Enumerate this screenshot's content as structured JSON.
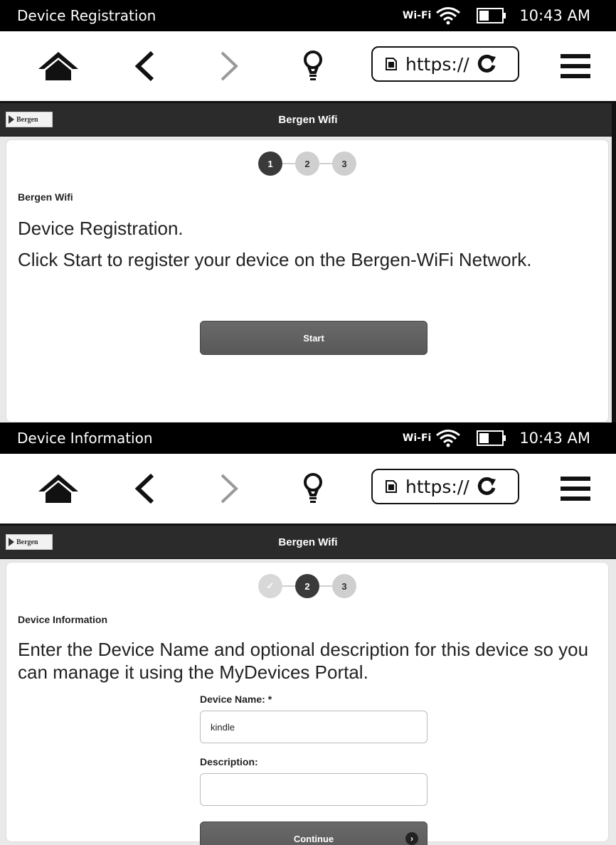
{
  "screens": [
    {
      "status": {
        "title": "Device Registration",
        "wifi_label": "Wi-Fi",
        "time": "10:43 AM"
      },
      "browser": {
        "url": "https://"
      },
      "app": {
        "title": "Bergen Wifi",
        "logo_text": "Bergen"
      },
      "steps": [
        "1",
        "2",
        "3"
      ],
      "section_label": "Bergen Wifi",
      "heading": "Device Registration.",
      "message": "Click Start to register your device on the Bergen-WiFi Network.",
      "button_label": "Start"
    },
    {
      "status": {
        "title": "Device Information",
        "wifi_label": "Wi-Fi",
        "time": "10:43 AM"
      },
      "browser": {
        "url": "https://"
      },
      "app": {
        "title": "Bergen Wifi",
        "logo_text": "Bergen"
      },
      "steps": [
        "✓",
        "2",
        "3"
      ],
      "section_label": "Device Information",
      "message": "Enter the Device Name and optional description for this device so you can manage it using the MyDevices Portal.",
      "fields": {
        "device_name_label": "Device Name: *",
        "device_name_value": "kindle",
        "description_label": "Description:",
        "description_value": ""
      },
      "button_label": "Continue"
    }
  ]
}
